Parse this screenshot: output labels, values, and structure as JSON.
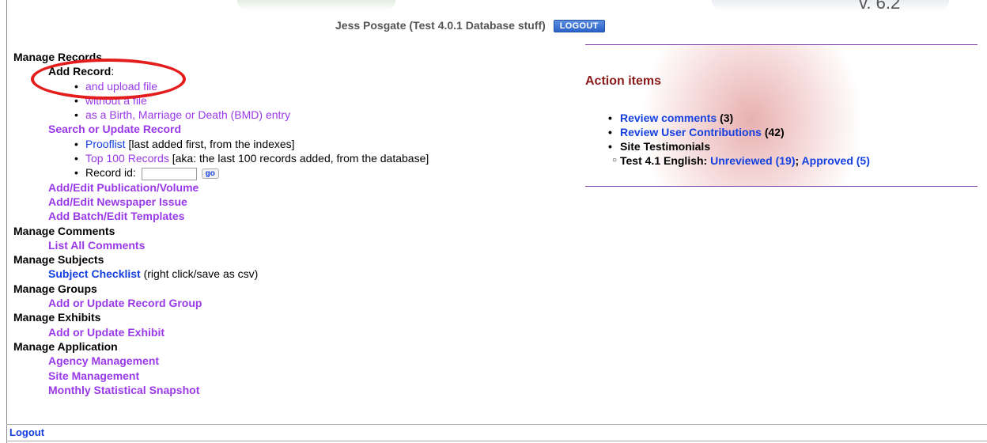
{
  "header": {
    "version_text": "v. 6.2",
    "user_name": "Jess Posgate",
    "site_context": "(Test 4.0.1 Database stuff)",
    "logout_button": "LOGOUT"
  },
  "menu": {
    "manage_records": "Manage Records",
    "add_record_label": "Add Record",
    "add_record_colon": ":",
    "add_record_options": [
      "and upload file",
      "without a file",
      "as a Birth, Marriage or Death (BMD) entry"
    ],
    "search_update_record": "Search or Update Record",
    "prooflist_link": "Prooflist",
    "prooflist_note": "[last added first, from the indexes]",
    "top100_link": "Top 100 Records",
    "top100_note": "[aka: the last 100 records added, from the database]",
    "record_id_label": "Record id:",
    "record_id_value": "",
    "go_button": "go",
    "add_edit_publication": "Add/Edit Publication/Volume",
    "add_edit_newspaper": "Add/Edit Newspaper Issue",
    "add_batch_templates": "Add Batch/Edit Templates",
    "manage_comments": "Manage Comments",
    "list_all_comments": "List All Comments",
    "manage_subjects": "Manage Subjects",
    "subject_checklist": "Subject Checklist",
    "subject_checklist_note": "(right click/save as csv)",
    "manage_groups": "Manage Groups",
    "add_update_group": "Add or Update Record Group",
    "manage_exhibits": "Manage Exhibits",
    "add_update_exhibit": "Add or Update Exhibit",
    "manage_application": "Manage Application",
    "agency_management": "Agency Management",
    "site_management": "Site Management",
    "monthly_snapshot": "Monthly Statistical Snapshot"
  },
  "action_items": {
    "title": "Action items",
    "review_comments": "Review comments",
    "review_comments_count": "(3)",
    "review_contributions": "Review User Contributions",
    "review_contributions_count": "(42)",
    "site_testimonials": "Site Testimonials",
    "testimonial_language": "Test 4.1 English:",
    "unreviewed": "Unreviewed (19)",
    "separator": ";",
    "approved": "Approved (5)"
  },
  "footer": {
    "logout": "Logout"
  },
  "colors": {
    "link_purple": "#9a39e8",
    "link_blue": "#1440e0",
    "action_title": "#8b1a1a",
    "annotation_red": "#e31c1c"
  }
}
